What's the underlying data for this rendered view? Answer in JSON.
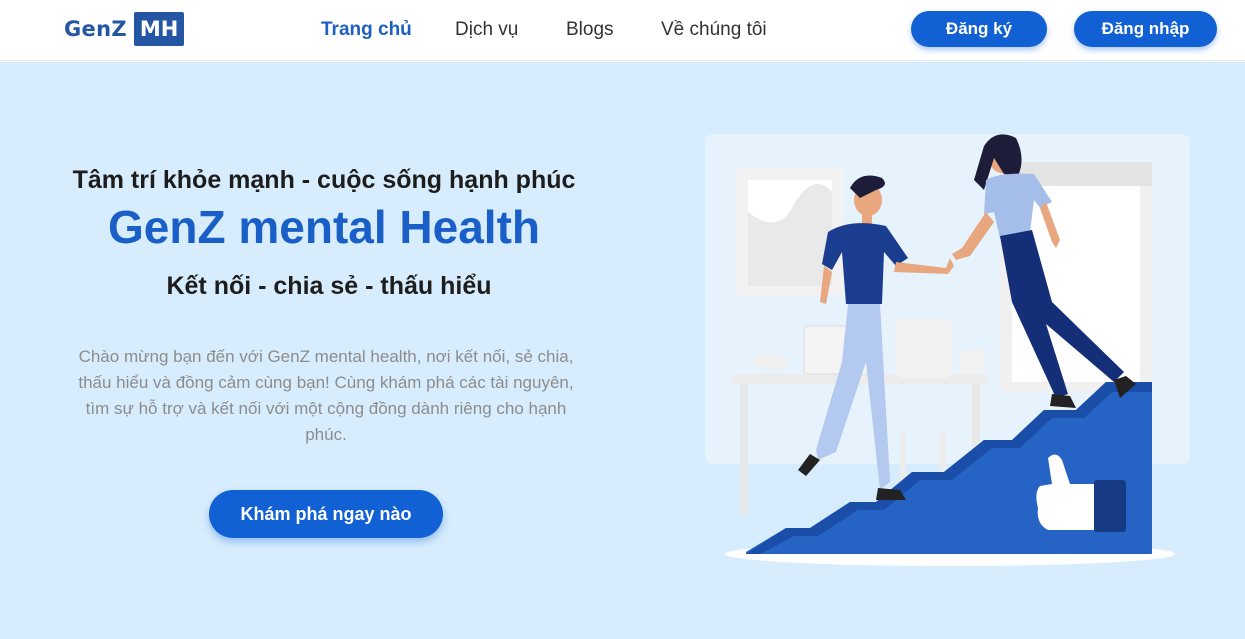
{
  "header": {
    "logo_text": "GenZ",
    "logo_box": "MH",
    "nav": [
      "Trang chủ",
      "Dịch vụ",
      "Blogs",
      "Về chúng tôi"
    ],
    "register_label": "Đăng ký",
    "login_label": "Đăng nhập"
  },
  "hero": {
    "tagline": "Tâm trí khỏe mạnh - cuộc sống hạnh phúc",
    "title": "GenZ mental Health",
    "subtitle": "Kết nối - chia sẻ - thấu hiểu",
    "description": "Chào mừng bạn đến với GenZ mental health, nơi kết nối, sẻ chia, thấu hiểu và đồng cảm cùng bạn! Cùng khám phá các tài nguyên, tìm sự hỗ trợ và kết nối với một cộng đồng dành riêng cho hạnh phúc.",
    "cta_label": "Khám phá ngay nào"
  },
  "illustration": {
    "subject": "two people shaking hands while climbing blue stairs with a thumbs-up icon"
  },
  "colors": {
    "primary": "#1160d4",
    "brand": "#2456a4",
    "hero_bg": "#d7edfd",
    "title_blue": "#1a5fc7"
  }
}
